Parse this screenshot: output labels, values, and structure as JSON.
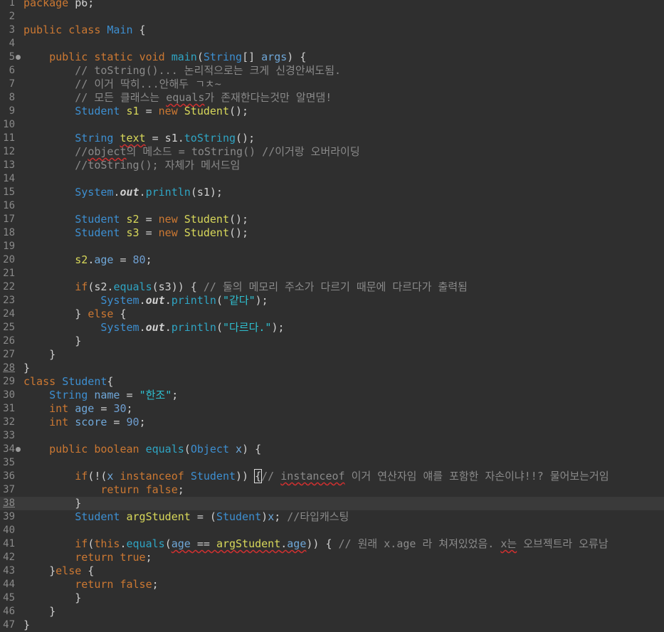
{
  "editor": {
    "current_line": 38,
    "lines": [
      {
        "n": "1",
        "t": [
          [
            "kw",
            "package"
          ],
          [
            "text",
            " p6;"
          ]
        ]
      },
      {
        "n": "2",
        "t": []
      },
      {
        "n": "3",
        "t": [
          [
            "kw",
            "public"
          ],
          [
            "text",
            " "
          ],
          [
            "kw",
            "class"
          ],
          [
            "text",
            " "
          ],
          [
            "type",
            "Main"
          ],
          [
            "text",
            " {"
          ]
        ]
      },
      {
        "n": "4",
        "t": []
      },
      {
        "n": "5",
        "fold": true,
        "t": [
          [
            "text",
            "    "
          ],
          [
            "kw",
            "public"
          ],
          [
            "text",
            " "
          ],
          [
            "kw",
            "static"
          ],
          [
            "text",
            " "
          ],
          [
            "kw",
            "void"
          ],
          [
            "text",
            " "
          ],
          [
            "method",
            "main"
          ],
          [
            "text",
            "("
          ],
          [
            "type",
            "String"
          ],
          [
            "text",
            "[] "
          ],
          [
            "field",
            "args"
          ],
          [
            "text",
            ") {"
          ]
        ]
      },
      {
        "n": "6",
        "t": [
          [
            "text",
            "        "
          ],
          [
            "comment",
            "// toString()... 논리적으로는 크게 신경안써도됨."
          ]
        ]
      },
      {
        "n": "7",
        "t": [
          [
            "text",
            "        "
          ],
          [
            "comment",
            "// 이거 딱히...안해두 ㄱㅊ~"
          ]
        ]
      },
      {
        "n": "8",
        "t": [
          [
            "text",
            "        "
          ],
          [
            "comment",
            "// 모든 클래스는 "
          ],
          [
            "comment",
            "equals",
            "sq"
          ],
          [
            "comment",
            "가 존재한다는것만 알면댐!"
          ]
        ]
      },
      {
        "n": "9",
        "t": [
          [
            "text",
            "        "
          ],
          [
            "type",
            "Student"
          ],
          [
            "text",
            " "
          ],
          [
            "var",
            "s1"
          ],
          [
            "text",
            " = "
          ],
          [
            "kw",
            "new"
          ],
          [
            "text",
            " "
          ],
          [
            "var",
            "Student"
          ],
          [
            "text",
            "();"
          ]
        ]
      },
      {
        "n": "10",
        "t": []
      },
      {
        "n": "11",
        "t": [
          [
            "text",
            "        "
          ],
          [
            "type",
            "String"
          ],
          [
            "text",
            " "
          ],
          [
            "var",
            "text",
            "sq"
          ],
          [
            "text",
            " = s1."
          ],
          [
            "method",
            "toString"
          ],
          [
            "text",
            "();"
          ]
        ]
      },
      {
        "n": "12",
        "t": [
          [
            "text",
            "        "
          ],
          [
            "comment",
            "//"
          ],
          [
            "comment",
            "object",
            "sq"
          ],
          [
            "comment",
            "의 메소드 = toString() //이거랑 오버라이딩"
          ]
        ]
      },
      {
        "n": "13",
        "t": [
          [
            "text",
            "        "
          ],
          [
            "comment",
            "//toString(); 자체가 메서드임"
          ]
        ]
      },
      {
        "n": "14",
        "t": []
      },
      {
        "n": "15",
        "t": [
          [
            "text",
            "        "
          ],
          [
            "type",
            "System"
          ],
          [
            "text",
            "."
          ],
          [
            "static",
            "out"
          ],
          [
            "text",
            "."
          ],
          [
            "method",
            "println"
          ],
          [
            "text",
            "(s1);"
          ]
        ]
      },
      {
        "n": "16",
        "t": []
      },
      {
        "n": "17",
        "t": [
          [
            "text",
            "        "
          ],
          [
            "type",
            "Student"
          ],
          [
            "text",
            " "
          ],
          [
            "var",
            "s2"
          ],
          [
            "text",
            " = "
          ],
          [
            "kw",
            "new"
          ],
          [
            "text",
            " "
          ],
          [
            "var",
            "Student"
          ],
          [
            "text",
            "();"
          ]
        ]
      },
      {
        "n": "18",
        "t": [
          [
            "text",
            "        "
          ],
          [
            "type",
            "Student"
          ],
          [
            "text",
            " "
          ],
          [
            "var",
            "s3"
          ],
          [
            "text",
            " = "
          ],
          [
            "kw",
            "new"
          ],
          [
            "text",
            " "
          ],
          [
            "var",
            "Student"
          ],
          [
            "text",
            "();"
          ]
        ]
      },
      {
        "n": "19",
        "t": []
      },
      {
        "n": "20",
        "t": [
          [
            "text",
            "        "
          ],
          [
            "var",
            "s2"
          ],
          [
            "text",
            "."
          ],
          [
            "field",
            "age"
          ],
          [
            "text",
            " = "
          ],
          [
            "number",
            "80"
          ],
          [
            "text",
            ";"
          ]
        ]
      },
      {
        "n": "21",
        "t": []
      },
      {
        "n": "22",
        "t": [
          [
            "text",
            "        "
          ],
          [
            "kw",
            "if"
          ],
          [
            "text",
            "(s2."
          ],
          [
            "method",
            "equals"
          ],
          [
            "text",
            "(s3)) { "
          ],
          [
            "comment",
            "// 둘의 메모리 주소가 다르기 때문에 다르다가 출력됨"
          ]
        ]
      },
      {
        "n": "23",
        "t": [
          [
            "text",
            "            "
          ],
          [
            "type",
            "System"
          ],
          [
            "text",
            "."
          ],
          [
            "static",
            "out"
          ],
          [
            "text",
            "."
          ],
          [
            "method",
            "println"
          ],
          [
            "text",
            "("
          ],
          [
            "string",
            "\"같다\""
          ],
          [
            "text",
            ");"
          ]
        ]
      },
      {
        "n": "24",
        "t": [
          [
            "text",
            "        } "
          ],
          [
            "kw",
            "else"
          ],
          [
            "text",
            " {"
          ]
        ]
      },
      {
        "n": "25",
        "t": [
          [
            "text",
            "            "
          ],
          [
            "type",
            "System"
          ],
          [
            "text",
            "."
          ],
          [
            "static",
            "out"
          ],
          [
            "text",
            "."
          ],
          [
            "method",
            "println"
          ],
          [
            "text",
            "("
          ],
          [
            "string",
            "\"다르다.\""
          ],
          [
            "text",
            ");"
          ]
        ]
      },
      {
        "n": "26",
        "t": [
          [
            "text",
            "        }"
          ]
        ]
      },
      {
        "n": "27",
        "t": [
          [
            "text",
            "    }"
          ]
        ]
      },
      {
        "n": "28",
        "ul": true,
        "t": [
          [
            "text",
            "}"
          ]
        ]
      },
      {
        "n": "29",
        "t": [
          [
            "kw",
            "class"
          ],
          [
            "text",
            " "
          ],
          [
            "type",
            "Student"
          ],
          [
            "text",
            "{"
          ]
        ]
      },
      {
        "n": "30",
        "t": [
          [
            "text",
            "    "
          ],
          [
            "type",
            "String"
          ],
          [
            "text",
            " "
          ],
          [
            "field",
            "name"
          ],
          [
            "text",
            " = "
          ],
          [
            "string",
            "\"한조\""
          ],
          [
            "text",
            ";"
          ]
        ]
      },
      {
        "n": "31",
        "t": [
          [
            "text",
            "    "
          ],
          [
            "kw",
            "int"
          ],
          [
            "text",
            " "
          ],
          [
            "field",
            "age"
          ],
          [
            "text",
            " = "
          ],
          [
            "number",
            "30"
          ],
          [
            "text",
            ";"
          ]
        ]
      },
      {
        "n": "32",
        "t": [
          [
            "text",
            "    "
          ],
          [
            "kw",
            "int"
          ],
          [
            "text",
            " "
          ],
          [
            "field",
            "score"
          ],
          [
            "text",
            " = "
          ],
          [
            "number",
            "90"
          ],
          [
            "text",
            ";"
          ]
        ]
      },
      {
        "n": "33",
        "t": []
      },
      {
        "n": "34",
        "fold": true,
        "t": [
          [
            "text",
            "    "
          ],
          [
            "kw",
            "public"
          ],
          [
            "text",
            " "
          ],
          [
            "kw",
            "boolean"
          ],
          [
            "text",
            " "
          ],
          [
            "method",
            "equals"
          ],
          [
            "text",
            "("
          ],
          [
            "type",
            "Object"
          ],
          [
            "text",
            " "
          ],
          [
            "field",
            "x"
          ],
          [
            "text",
            ") {"
          ]
        ]
      },
      {
        "n": "35",
        "t": []
      },
      {
        "n": "36",
        "t": [
          [
            "text",
            "        "
          ],
          [
            "kw",
            "if"
          ],
          [
            "text",
            "(!("
          ],
          [
            "field",
            "x"
          ],
          [
            "text",
            " "
          ],
          [
            "kw",
            "instanceof"
          ],
          [
            "text",
            " "
          ],
          [
            "type",
            "Student"
          ],
          [
            "text",
            "))"
          ],
          [
            "text",
            " "
          ],
          [
            "cursor",
            "{"
          ],
          [
            "comment",
            "// "
          ],
          [
            "comment",
            "instanceof",
            "sq"
          ],
          [
            "comment",
            " 이거 연산자임 얘를 포함한 자손이냐!!? 물어보는거임"
          ]
        ]
      },
      {
        "n": "37",
        "t": [
          [
            "text",
            "            "
          ],
          [
            "kw",
            "return"
          ],
          [
            "text",
            " "
          ],
          [
            "kw",
            "false"
          ],
          [
            "text",
            ";"
          ]
        ]
      },
      {
        "n": "38",
        "ul": true,
        "t": [
          [
            "text",
            "        }"
          ]
        ]
      },
      {
        "n": "39",
        "t": [
          [
            "text",
            "        "
          ],
          [
            "type",
            "Student"
          ],
          [
            "text",
            " "
          ],
          [
            "var",
            "argStudent"
          ],
          [
            "text",
            " = ("
          ],
          [
            "type",
            "Student"
          ],
          [
            "text",
            ")"
          ],
          [
            "field",
            "x"
          ],
          [
            "text",
            "; "
          ],
          [
            "comment",
            "//타입캐스팅"
          ]
        ]
      },
      {
        "n": "40",
        "t": []
      },
      {
        "n": "41",
        "t": [
          [
            "text",
            "        "
          ],
          [
            "kw",
            "if"
          ],
          [
            "text",
            "("
          ],
          [
            "kw",
            "this"
          ],
          [
            "text",
            "."
          ],
          [
            "method",
            "equals"
          ],
          [
            "text",
            "("
          ],
          [
            "field",
            "age",
            "sq"
          ],
          [
            "text",
            " == ",
            "sq"
          ],
          [
            "var",
            "argStudent",
            "sq"
          ],
          [
            "text",
            ".",
            "sq"
          ],
          [
            "field",
            "age",
            "sq"
          ],
          [
            "text",
            ")) { "
          ],
          [
            "comment",
            "// 원래 x.age 라 쳐져있었음. "
          ],
          [
            "comment",
            "x는",
            "sq"
          ],
          [
            "comment",
            " 오브젝트라 오류남"
          ]
        ]
      },
      {
        "n": "42",
        "t": [
          [
            "text",
            "        "
          ],
          [
            "kw",
            "return"
          ],
          [
            "text",
            " "
          ],
          [
            "kw",
            "true"
          ],
          [
            "text",
            ";"
          ]
        ]
      },
      {
        "n": "43",
        "t": [
          [
            "text",
            "    }"
          ],
          [
            "kw",
            "else"
          ],
          [
            "text",
            " {"
          ]
        ]
      },
      {
        "n": "44",
        "t": [
          [
            "text",
            "        "
          ],
          [
            "kw",
            "return"
          ],
          [
            "text",
            " "
          ],
          [
            "kw",
            "false"
          ],
          [
            "text",
            ";"
          ]
        ]
      },
      {
        "n": "45",
        "t": [
          [
            "text",
            "        }"
          ]
        ]
      },
      {
        "n": "46",
        "t": [
          [
            "text",
            "    }"
          ]
        ]
      },
      {
        "n": "47",
        "t": [
          [
            "text",
            "}"
          ]
        ]
      }
    ]
  },
  "colors": {
    "background": "#2f2f2f",
    "keyword": "#cc7832",
    "type": "#3d8fd1",
    "method": "#2fa5c4",
    "string": "#2fc0d0",
    "comment": "#8a8a8a"
  }
}
